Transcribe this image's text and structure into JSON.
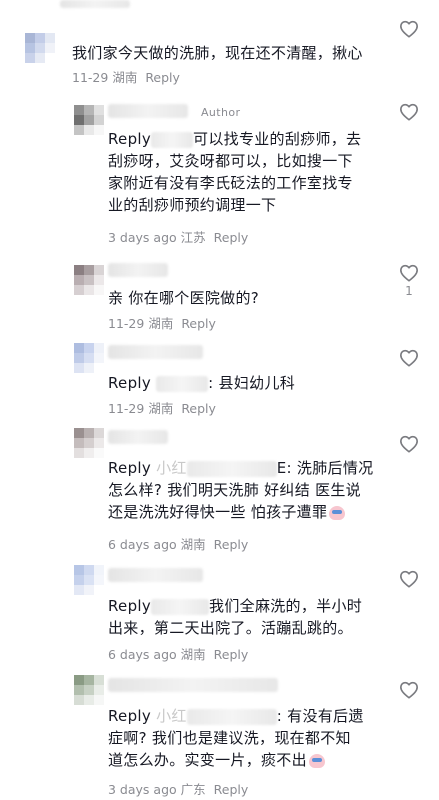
{
  "comments": [
    {
      "id": "c0",
      "text": "我们家今天做的洗肺，现在还不清醒，揪心",
      "date": "11-29",
      "location": "湖南",
      "reply_label": "Reply",
      "likes": "",
      "avatar": [
        "#a9b6d6",
        "#c3cde8",
        "#e3e8f3",
        "#b7c4e2",
        "#d2daee",
        "#f0f2f8",
        "#c9d2ea",
        "#e6eaf4",
        "#ffffff"
      ]
    },
    {
      "id": "c1",
      "author_tag": "Author",
      "reply_prefix": "Reply",
      "text_line1_suffix": "可以找专业的刮痧师，去",
      "text_rest": "刮痧呀，艾灸呀都可以，比如搜一下\n家附近有没有李氏砭法的工作室找专\n业的刮痧师预约调理一下",
      "date": "3 days ago",
      "location": "江苏",
      "reply_label": "Reply",
      "likes": "",
      "avatar": [
        "#8f8f8f",
        "#b5b5b5",
        "#e0e0e0",
        "#6f6f6f",
        "#a2a2a2",
        "#d3d3d3",
        "#c4c4c4",
        "#e9e9e9",
        "#f7f7f7"
      ]
    },
    {
      "id": "c2",
      "text": "亲 你在哪个医院做的?",
      "date": "11-29",
      "location": "湖南",
      "reply_label": "Reply",
      "likes": "1",
      "avatar": [
        "#8b7f82",
        "#a89ea0",
        "#d9d4d5",
        "#b9aeb1",
        "#c9c1c3",
        "#ece8e9",
        "#d6cfd1",
        "#eae6e7",
        "#f8f7f7"
      ]
    },
    {
      "id": "c3",
      "reply_prefix": "Reply",
      "text_line1_suffix": ": 县妇幼儿科",
      "date": "11-29",
      "location": "湖南",
      "reply_label": "Reply",
      "likes": "",
      "avatar": [
        "#aebde0",
        "#c8d3ee",
        "#eef1f8",
        "#bfcbe8",
        "#d6def2",
        "#f3f5fa",
        "#dde3f3",
        "#eef1f8",
        "#ffffff"
      ]
    },
    {
      "id": "c4",
      "reply_prefix": "Reply",
      "reply_name_visible": "小红",
      "text_line1_suffix": "E: 洗肺后情况",
      "text_rest": "怎么样? 我们明天洗肺 好纠结 医生说\n还是洗洗好得快一些 怕孩子遭罪",
      "date": "6 days ago",
      "location": "湖南",
      "reply_label": "Reply",
      "likes": "",
      "avatar": [
        "#9a9090",
        "#b9b1b1",
        "#dcd8d8",
        "#c4bcbc",
        "#d5cfcf",
        "#ece9e9",
        "#e3dfdf",
        "#f0eeee",
        "#fafafa"
      ]
    },
    {
      "id": "c5",
      "reply_prefix": "Reply",
      "text_line1_suffix": "我们全麻洗的，半小时",
      "text_rest": "出来，第二天出院了。活蹦乱跳的。",
      "date": "6 days ago",
      "location": "湖南",
      "reply_label": "Reply",
      "likes": "",
      "avatar": [
        "#b7c6e6",
        "#cfd9f0",
        "#f1f4fa",
        "#c5d1ec",
        "#dae2f4",
        "#f4f6fb",
        "#e3e8f5",
        "#f1f3f9",
        "#ffffff"
      ]
    },
    {
      "id": "c6",
      "reply_prefix": "Reply",
      "reply_name_visible": "小红",
      "text_line1_suffix": ": 有没有后遗",
      "text_rest": "症啊? 我们也是建议洗，现在都不知\n道怎么办。实变一片，痰不出",
      "date": "3 days ago",
      "location": "广东",
      "reply_label": "Reply",
      "likes": "",
      "avatar": [
        "#8a9b84",
        "#a6b5a1",
        "#d8dfd6",
        "#b2bfae",
        "#c7d1c4",
        "#e9ede8",
        "#d7ddd5",
        "#e8ece7",
        "#f6f7f6"
      ]
    }
  ],
  "colors": {
    "text": "#161823",
    "meta": "#8a8b91",
    "icon": "#7a7b80"
  },
  "icons": {
    "like": "heart-outline-icon"
  }
}
